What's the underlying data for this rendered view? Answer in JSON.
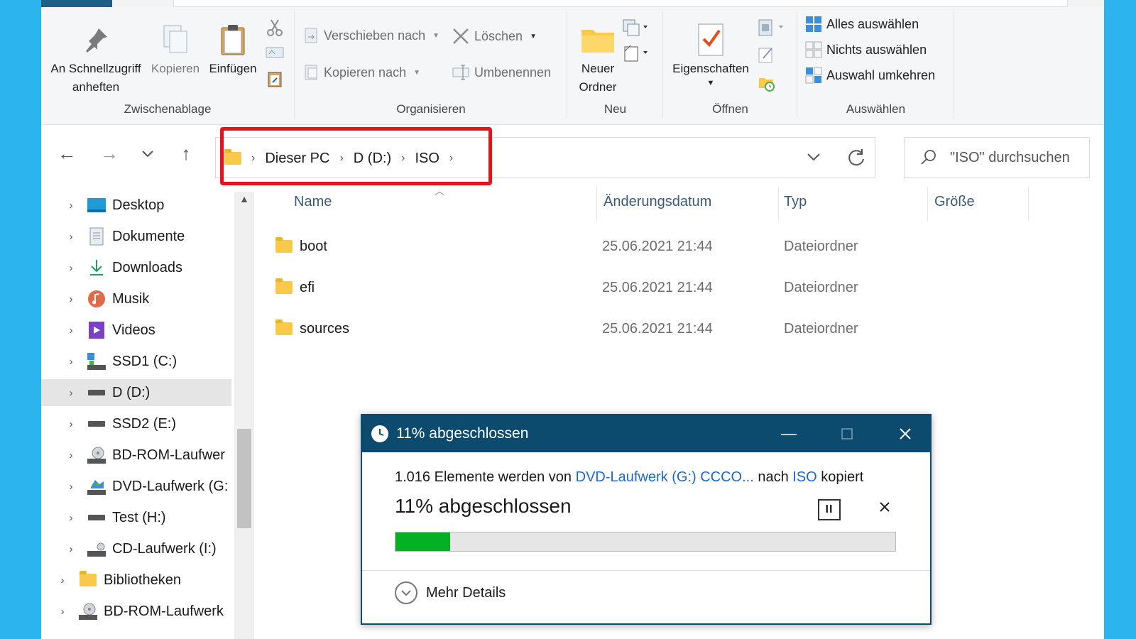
{
  "ribbon": {
    "clipboard": {
      "label": "Zwischenablage",
      "pin_line1": "An Schnellzugriff",
      "pin_line2": "anheften",
      "copy": "Kopieren",
      "paste": "Einfügen"
    },
    "organize": {
      "label": "Organisieren",
      "move_to": "Verschieben nach",
      "copy_to": "Kopieren nach",
      "delete": "Löschen",
      "rename": "Umbenennen"
    },
    "new": {
      "label": "Neu",
      "new_folder_line1": "Neuer",
      "new_folder_line2": "Ordner"
    },
    "open": {
      "label": "Öffnen",
      "properties": "Eigenschaften"
    },
    "select": {
      "label": "Auswählen",
      "select_all": "Alles auswählen",
      "select_none": "Nichts auswählen",
      "invert": "Auswahl umkehren"
    }
  },
  "address": {
    "crumbs": [
      "Dieser PC",
      "D (D:)",
      "ISO"
    ]
  },
  "search": {
    "placeholder": "\"ISO\" durchsuchen"
  },
  "sidebar": {
    "items": [
      {
        "label": "Desktop"
      },
      {
        "label": "Dokumente"
      },
      {
        "label": "Downloads"
      },
      {
        "label": "Musik"
      },
      {
        "label": "Videos"
      },
      {
        "label": "SSD1 (C:)"
      },
      {
        "label": "D (D:)"
      },
      {
        "label": "SSD2 (E:)"
      },
      {
        "label": "BD-ROM-Laufwer"
      },
      {
        "label": "DVD-Laufwerk (G:"
      },
      {
        "label": "Test (H:)"
      },
      {
        "label": "CD-Laufwerk (I:)"
      },
      {
        "label": "Bibliotheken"
      },
      {
        "label": "BD-ROM-Laufwerk"
      }
    ],
    "selected_index": 6
  },
  "columns": {
    "name": "Name",
    "date": "Änderungsdatum",
    "type": "Typ",
    "size": "Größe"
  },
  "files": [
    {
      "name": "boot",
      "date": "25.06.2021 21:44",
      "type": "Dateiordner"
    },
    {
      "name": "efi",
      "date": "25.06.2021 21:44",
      "type": "Dateiordner"
    },
    {
      "name": "sources",
      "date": "25.06.2021 21:44",
      "type": "Dateiordner"
    }
  ],
  "dialog": {
    "title": "11% abgeschlossen",
    "line_prefix": "1.016 Elemente werden von",
    "source": "DVD-Laufwerk (G:) CCCO...",
    "line_mid": "nach",
    "destination": "ISO",
    "line_suffix": "kopiert",
    "status": "11% abgeschlossen",
    "progress_percent": 11,
    "more_details": "Mehr Details"
  },
  "colors": {
    "accent": "#0c4a6e",
    "progress_fill": "#06b025",
    "highlight_box": "#e3141b",
    "desktop_bg": "#2bb4ee"
  }
}
